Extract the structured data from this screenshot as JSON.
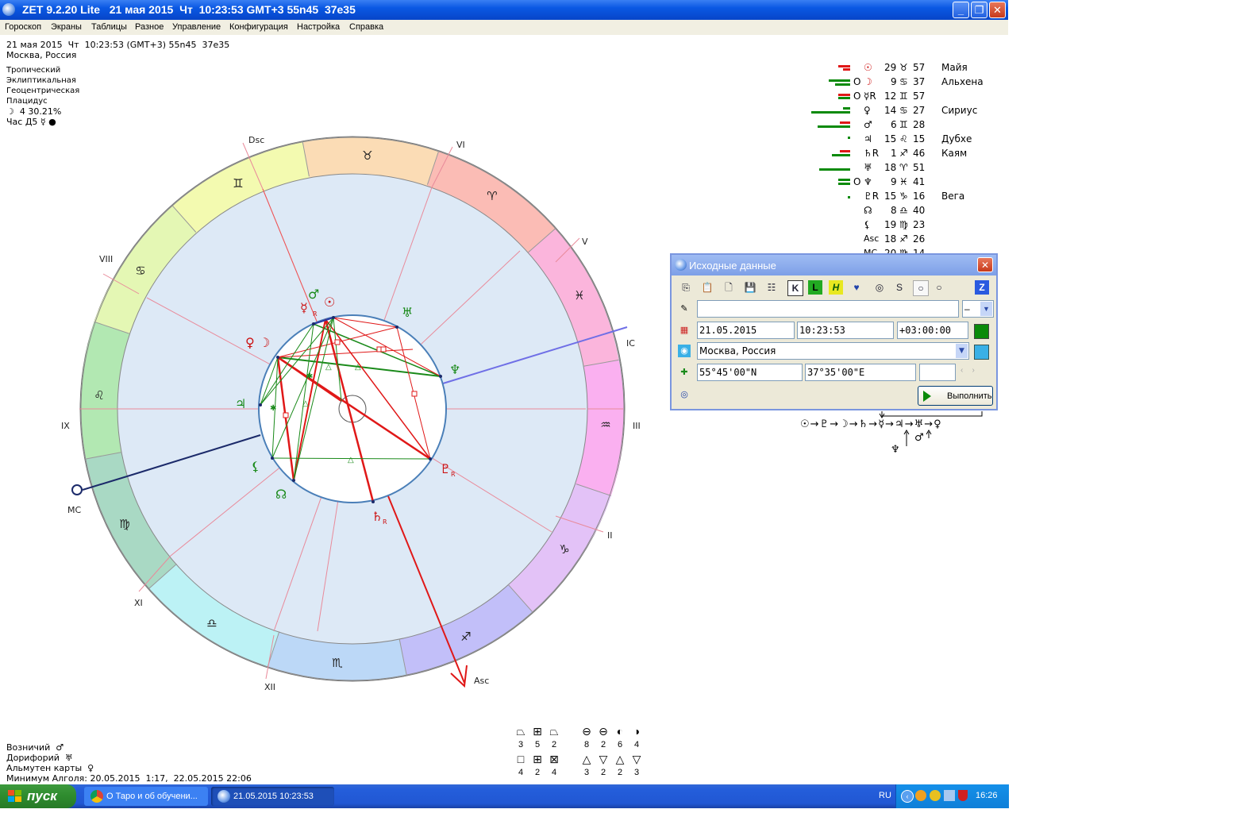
{
  "window": {
    "title": "ZET 9.2.20 Lite   21 мая 2015  Чт  10:23:53 GMT+3 55n45  37e35"
  },
  "menu": [
    "Гороскоп",
    "Экраны",
    "Таблицы",
    "Разное",
    "Управление",
    "Конфигурация",
    "Настройка",
    "Справка"
  ],
  "info": {
    "line1": "21 мая 2015  Чт  10:23:53 (GMT+3) 55n45  37e35",
    "line2": "Москва, Россия",
    "settings": [
      "Тропический",
      "Эклиптикальная",
      "Геоцентрическая",
      "Плацидус"
    ],
    "moon_phase": "☽  4 30.21%",
    "hour": "Час Д5 ☿ ●"
  },
  "houses": [
    "Dsc",
    "VI",
    "V",
    "IC",
    "III",
    "II",
    "Asc",
    "XII",
    "XI",
    "MC",
    "IX",
    "VIII"
  ],
  "signs": [
    "♉",
    "♈",
    "♓",
    "♒",
    "♑",
    "♐",
    "♏",
    "♎",
    "♍",
    "♌",
    "♋",
    "♊"
  ],
  "chart_planets": [
    {
      "glyph": "♂",
      "color": "#1a8a1a"
    },
    {
      "glyph": "☉",
      "color": "#cc1111"
    },
    {
      "glyph": "☿",
      "color": "#cc1111"
    },
    {
      "glyph": "♅",
      "color": "#1a8a1a"
    },
    {
      "glyph": "♀",
      "color": "#cc1111"
    },
    {
      "glyph": "☽",
      "color": "#cc1111"
    },
    {
      "glyph": "♆",
      "color": "#1a8a1a"
    },
    {
      "glyph": "♃",
      "color": "#1a8a1a"
    },
    {
      "glyph": "⚸",
      "color": "#1a8a1a"
    },
    {
      "glyph": "☊",
      "color": "#1a8a1a"
    },
    {
      "glyph": "♇",
      "color": "#cc1111"
    },
    {
      "glyph": "♄",
      "color": "#cc1111"
    },
    {
      "glyph": "R",
      "color": "#cc1111"
    },
    {
      "glyph": "R",
      "color": "#cc1111"
    },
    {
      "glyph": "R",
      "color": "#cc1111"
    }
  ],
  "planet_table": [
    {
      "mark": "",
      "glyph": "☉",
      "deg": "29",
      "sign": "♉",
      "min": "57",
      "star": "Майя"
    },
    {
      "mark": "O",
      "glyph": "☽",
      "deg": "9",
      "sign": "♋",
      "min": "37",
      "star": "Альхена"
    },
    {
      "mark": "O",
      "glyph": "☿R",
      "deg": "12",
      "sign": "♊",
      "min": "57",
      "star": ""
    },
    {
      "mark": "",
      "glyph": "♀",
      "deg": "14",
      "sign": "♋",
      "min": "27",
      "star": "Сириус"
    },
    {
      "mark": "",
      "glyph": "♂",
      "deg": "6",
      "sign": "♊",
      "min": "28",
      "star": ""
    },
    {
      "mark": "",
      "glyph": "♃",
      "deg": "15",
      "sign": "♌",
      "min": "15",
      "star": "Дубхе"
    },
    {
      "mark": "",
      "glyph": "♄R",
      "deg": "1",
      "sign": "♐",
      "min": "46",
      "star": "Каям"
    },
    {
      "mark": "",
      "glyph": "♅",
      "deg": "18",
      "sign": "♈",
      "min": "51",
      "star": ""
    },
    {
      "mark": "O",
      "glyph": "♆",
      "deg": "9",
      "sign": "♓",
      "min": "41",
      "star": ""
    },
    {
      "mark": "",
      "glyph": "♇R",
      "deg": "15",
      "sign": "♑",
      "min": "16",
      "star": "Вега"
    },
    {
      "mark": "",
      "glyph": "☊",
      "deg": "8",
      "sign": "♎",
      "min": "40",
      "star": ""
    },
    {
      "mark": "",
      "glyph": "⚸",
      "deg": "19",
      "sign": "♍",
      "min": "23",
      "star": ""
    },
    {
      "mark": "",
      "glyph": "Asc",
      "deg": "18",
      "sign": "♐",
      "min": "26",
      "star": ""
    },
    {
      "mark": "",
      "glyph": "MC",
      "deg": "20",
      "sign": "♍",
      "min": "14",
      "star": ""
    }
  ],
  "dialog": {
    "title": "Исходные данные",
    "toolbar": [
      "⎘",
      "📋",
      "🗋",
      "💾",
      "☷",
      "K",
      "L",
      "H",
      "♥",
      "◎",
      "S",
      "○",
      "○",
      "Z"
    ],
    "name_value": "",
    "combo_small": "–",
    "date": "21.05.2015",
    "time": "10:23:53",
    "tz": "+03:00:00",
    "place": "Москва, Россия",
    "lat": "55°45'00\"N",
    "lon": "37°35'00\"E",
    "run_label": "Выполнить"
  },
  "dispositor": {
    "chain": "☉→♇→☽→♄→☿→♃→♅→♀",
    "neptune": "♆",
    "mars": "♂"
  },
  "symbols_top": {
    "glyphs": [
      "⏢",
      "⊞",
      "⏢",
      "⊖",
      "⊖",
      "◐",
      "◑"
    ],
    "counts": [
      "3",
      "5",
      "2",
      "8",
      "2",
      "6",
      "4"
    ]
  },
  "symbols_bottom": {
    "glyphs": [
      "□",
      "⊞",
      "⊠",
      "△",
      "▽",
      "△",
      "▽"
    ],
    "counts": [
      "4",
      "2",
      "4",
      "3",
      "2",
      "2",
      "3"
    ]
  },
  "bottom_info": [
    {
      "label": "Возничий",
      "val": "♂"
    },
    {
      "label": "Дорифорий",
      "val": "♅"
    },
    {
      "label": "Альмутен карты",
      "val": "♀"
    },
    {
      "label": "Минимум Алголя: 20.05.2015  1:17,  22.05.2015 22:06",
      "val": ""
    }
  ],
  "taskbar": {
    "start": "пуск",
    "tasks": [
      "О Таро и об обучени...",
      "21.05.2015  10:23:53"
    ],
    "lang": "RU",
    "clock": "16:26"
  }
}
